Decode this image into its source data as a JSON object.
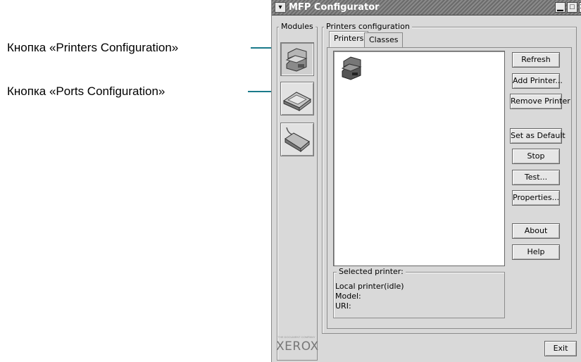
{
  "callouts": [
    {
      "text": "Кнопка «Printers Configuration»"
    },
    {
      "text": "Кнопка «Ports Configuration»"
    }
  ],
  "window": {
    "title": "MFP Configurator",
    "chevron": "▾",
    "minimize": "▁",
    "maximize": "□",
    "close": "✕"
  },
  "modules": {
    "label": "Modules",
    "items": [
      {
        "name": "printers-configuration",
        "icon": "printer-module-icon",
        "active": true
      },
      {
        "name": "ports-configuration",
        "icon": "scanner-module-icon",
        "active": false
      },
      {
        "name": "port-configuration",
        "icon": "port-connector-icon",
        "active": false
      }
    ],
    "brand": "XEROX",
    "brand_small": "THE DOCUMENT COMPANY"
  },
  "printers_config": {
    "label": "Printers configuration",
    "tabs": [
      {
        "label": "Printers",
        "active": true
      },
      {
        "label": "Classes",
        "active": false
      }
    ],
    "buttons": {
      "refresh": "Refresh",
      "add_printer": "Add Printer...",
      "remove_printer": "Remove Printer",
      "set_default": "Set as Default",
      "stop": "Stop",
      "test": "Test...",
      "properties": "Properties...",
      "about": "About",
      "help": "Help"
    },
    "selected_printer": {
      "label": "Selected printer:",
      "line1": "Local printer(idle)",
      "line2": "Model:",
      "line3": "URI:"
    }
  },
  "footer": {
    "exit": "Exit"
  }
}
